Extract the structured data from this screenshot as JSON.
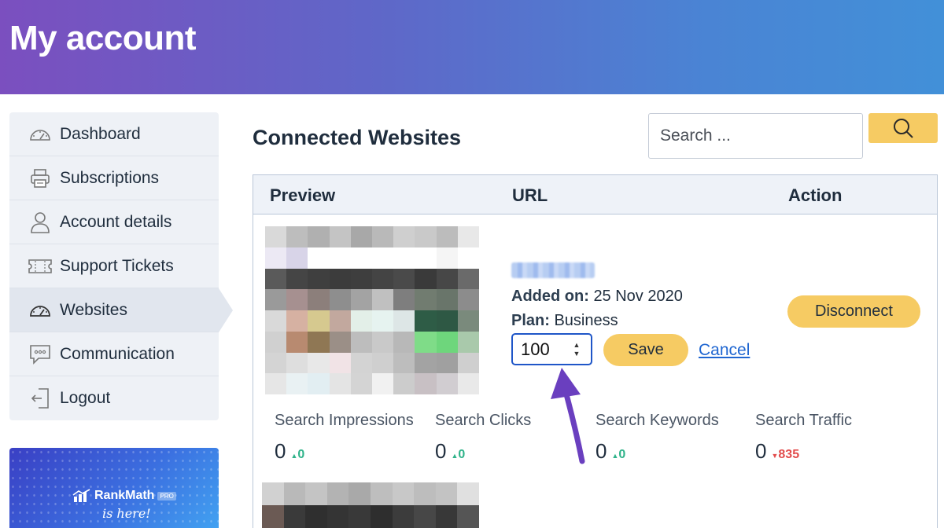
{
  "header": {
    "title": "My account"
  },
  "sidebar": {
    "items": [
      {
        "label": "Dashboard",
        "icon": "dashboard-gauge-icon"
      },
      {
        "label": "Subscriptions",
        "icon": "printer-icon"
      },
      {
        "label": "Account details",
        "icon": "user-icon"
      },
      {
        "label": "Support Tickets",
        "icon": "ticket-icon"
      },
      {
        "label": "Websites",
        "icon": "gauge-icon",
        "active": true
      },
      {
        "label": "Communication",
        "icon": "chat-bubble-icon"
      },
      {
        "label": "Logout",
        "icon": "logout-icon"
      }
    ]
  },
  "promo": {
    "brand": "RankMath",
    "badge": "PRO",
    "tagline": "is here!"
  },
  "main": {
    "title": "Connected Websites",
    "search": {
      "placeholder": "Search ...",
      "button_icon": "search-icon"
    }
  },
  "table": {
    "headers": {
      "preview": "Preview",
      "url": "URL",
      "action": "Action"
    },
    "row": {
      "url_text": "",
      "added_label": "Added on:",
      "added_value": "25 Nov 2020",
      "plan_label": "Plan:",
      "plan_value": "Business",
      "quantity_value": "100",
      "save_label": "Save",
      "cancel_label": "Cancel",
      "disconnect_label": "Disconnect",
      "stats": [
        {
          "label": "Search Impressions",
          "value": "0",
          "delta": "0",
          "direction": "up"
        },
        {
          "label": "Search Clicks",
          "value": "0",
          "delta": "0",
          "direction": "up"
        },
        {
          "label": "Search Keywords",
          "value": "0",
          "delta": "0",
          "direction": "up"
        },
        {
          "label": "Search Traffic",
          "value": "0",
          "delta": "835",
          "direction": "down"
        }
      ]
    }
  },
  "colors": {
    "accent_yellow": "#f6cb63",
    "link_blue": "#1f66d1",
    "positive": "#2fb38a",
    "negative": "#e24c4c",
    "annotation_arrow": "#6a3fbf"
  }
}
